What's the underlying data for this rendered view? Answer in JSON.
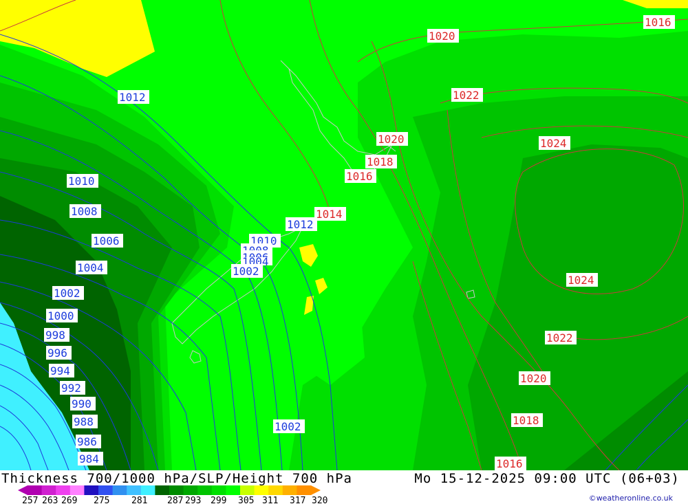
{
  "map": {
    "title": "Thickness 700/1000 hPa/SLP/Height 700 hPa",
    "valid_time": "Mo 15-12-2025 09:00 UTC (06+03)",
    "credit": "©weatheronline.co.uk"
  },
  "legend": {
    "ticks": [
      "257",
      "263",
      "269",
      "275",
      "281",
      "287",
      "293",
      "299",
      "305",
      "311",
      "317",
      "320"
    ],
    "colors": [
      "#b000b0",
      "#d020d0",
      "#ee40ee",
      "#ff80ff",
      "#2010c0",
      "#3050f0",
      "#3090f0",
      "#40c0ff",
      "#40f0ff",
      "#006400",
      "#008c00",
      "#00a800",
      "#00c400",
      "#00e000",
      "#00ff00",
      "#c8ff00",
      "#ffff00",
      "#ffd800",
      "#ffb000",
      "#ff9000"
    ]
  },
  "slp_labels_blue": [
    {
      "id": "b1012a",
      "text": "1012"
    },
    {
      "id": "b1010a",
      "text": "1010"
    },
    {
      "id": "b1008a",
      "text": "1008"
    },
    {
      "id": "b1006",
      "text": "1006"
    },
    {
      "id": "b1004a",
      "text": "1004"
    },
    {
      "id": "b1002a",
      "text": "1002"
    },
    {
      "id": "b1000",
      "text": "1000"
    },
    {
      "id": "b998",
      "text": "998"
    },
    {
      "id": "b996",
      "text": "996"
    },
    {
      "id": "b994",
      "text": "994"
    },
    {
      "id": "b992",
      "text": "992"
    },
    {
      "id": "b990",
      "text": "990"
    },
    {
      "id": "b988",
      "text": "988"
    },
    {
      "id": "b986",
      "text": "986"
    },
    {
      "id": "b984",
      "text": "984"
    },
    {
      "id": "b1012b",
      "text": "1012"
    },
    {
      "id": "b1010b",
      "text": "1010"
    },
    {
      "id": "b1008b",
      "text": "1008"
    },
    {
      "id": "b1006b",
      "text": "1006"
    },
    {
      "id": "b1004b",
      "text": "1004"
    },
    {
      "id": "b1002b",
      "text": "1002"
    },
    {
      "id": "b1002c",
      "text": "1002"
    }
  ],
  "slp_labels_red": [
    {
      "id": "r1016a",
      "text": "1016"
    },
    {
      "id": "r1020a",
      "text": "1020"
    },
    {
      "id": "r1022a",
      "text": "1022"
    },
    {
      "id": "r1020b",
      "text": "1020"
    },
    {
      "id": "r1018",
      "text": "1018"
    },
    {
      "id": "r1016b",
      "text": "1016"
    },
    {
      "id": "r1024a",
      "text": "1024"
    },
    {
      "id": "r1014",
      "text": "1014"
    },
    {
      "id": "r1024b",
      "text": "1024"
    },
    {
      "id": "r1022b",
      "text": "1022"
    },
    {
      "id": "r1020c",
      "text": "1020"
    },
    {
      "id": "r1018b",
      "text": "1018"
    },
    {
      "id": "r1016c",
      "text": "1016"
    }
  ]
}
